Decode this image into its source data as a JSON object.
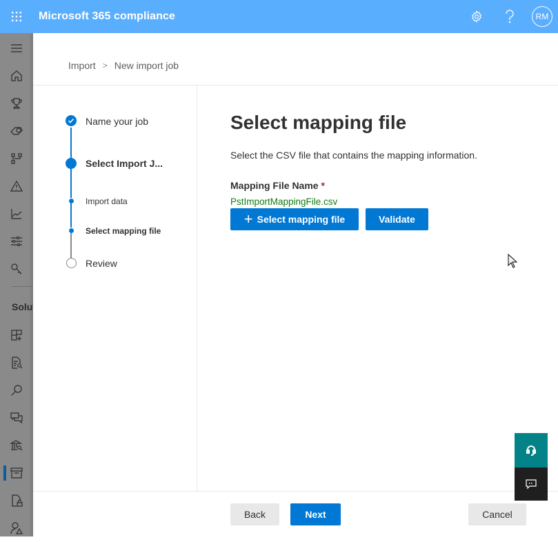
{
  "app": {
    "title": "Microsoft 365 compliance",
    "user_initials": "RM"
  },
  "header_icons": [
    "app-launcher-icon",
    "settings-icon",
    "help-icon"
  ],
  "nav": {
    "items": [
      {
        "name": "menu",
        "icon": "hamburger-icon"
      },
      {
        "name": "home",
        "icon": "home-icon"
      },
      {
        "name": "compliance-score",
        "icon": "trophy-icon"
      },
      {
        "name": "classification",
        "icon": "tag-icon"
      },
      {
        "name": "connectors",
        "icon": "org-chart-icon"
      },
      {
        "name": "alerts",
        "icon": "warning-icon"
      },
      {
        "name": "reports",
        "icon": "line-chart-icon"
      },
      {
        "name": "policies",
        "icon": "sliders-icon"
      },
      {
        "name": "permissions",
        "icon": "key-icon"
      }
    ],
    "section_label": "Solutions",
    "solution_items": [
      {
        "name": "catalog",
        "icon": "apps-add-icon"
      },
      {
        "name": "audit",
        "icon": "document-search-icon"
      },
      {
        "name": "content-search",
        "icon": "search-icon"
      },
      {
        "name": "communication-compliance",
        "icon": "chat-icon"
      },
      {
        "name": "ediscovery",
        "icon": "bank-search-icon"
      },
      {
        "name": "data-lifecycle",
        "icon": "archive-icon",
        "active": true
      },
      {
        "name": "information-protection",
        "icon": "document-lock-icon"
      },
      {
        "name": "insider-risk",
        "icon": "person-warning-icon"
      }
    ]
  },
  "breadcrumb": {
    "items": [
      "Import",
      "New import job"
    ],
    "separator": ">"
  },
  "wizard": {
    "steps": [
      {
        "label": "Name your job",
        "state": "completed"
      },
      {
        "label": "Select Import J...",
        "state": "current"
      },
      {
        "label": "Import data",
        "state": "substep-done"
      },
      {
        "label": "Select mapping file",
        "state": "substep-current"
      },
      {
        "label": "Review",
        "state": "pending"
      }
    ]
  },
  "main": {
    "title": "Select mapping file",
    "description": "Select the CSV file that contains the mapping information.",
    "field_label": "Mapping File Name",
    "required_marker": "*",
    "file_name": "PstImportMappingFile.csv",
    "select_button_label": "Select mapping file",
    "validate_button_label": "Validate"
  },
  "footer": {
    "back_label": "Back",
    "next_label": "Next",
    "cancel_label": "Cancel"
  },
  "floating": {
    "help_icon": "headset-icon",
    "feedback_icon": "feedback-icon"
  },
  "colors": {
    "topbar": "#5aaefe",
    "primary": "#0078d4",
    "success_text": "#107c10",
    "required": "#a4262c",
    "help_button": "#038387",
    "feedback_button": "#1f1f1f"
  }
}
